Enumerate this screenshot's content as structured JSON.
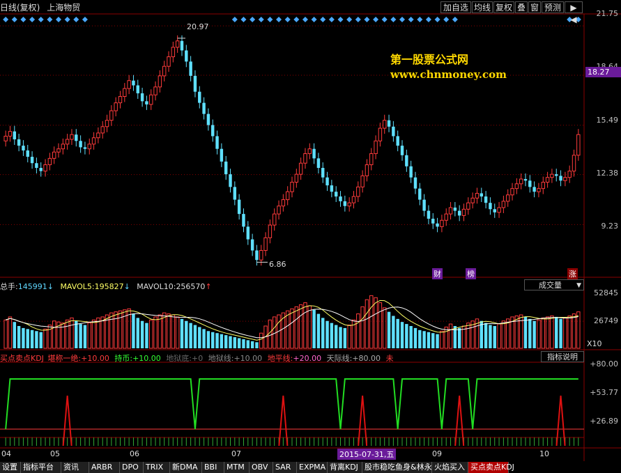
{
  "header": {
    "title": "日线(复权)",
    "stock_name": "上海物贸",
    "buttons": [
      "加自选",
      "均线",
      "复权",
      "叠",
      "窗",
      "预测",
      "▶ ◀"
    ]
  },
  "watermark": {
    "line1": "第一股票公式网",
    "line2": "www.chnmoney.com"
  },
  "price_panel": {
    "y_ticks": [
      "21.75",
      "18.64",
      "15.49",
      "12.38",
      "9.23"
    ],
    "current_price": "18.27",
    "high_label": "20.97",
    "low_label": "6.86",
    "badges": [
      "财",
      "榜",
      "涨"
    ],
    "accent_color": "#6a1b9a"
  },
  "volume_panel": {
    "label": "总手:",
    "total": "145991",
    "mavol5_label": "MAVOL5:",
    "mavol5": "195827",
    "mavol10_label": "MAVOL10:",
    "mavol10": "256570",
    "dropdown": "成交量",
    "y_ticks": [
      "52845",
      "26749"
    ],
    "multiplier": "X10"
  },
  "indicator_panel": {
    "title": "买点卖点KDJ",
    "line1_label": "堪称一绝:",
    "line1_value": "+10.00",
    "line2_label": "持币:",
    "line2_value": "+10.00",
    "line3_label": "地狱底:",
    "line3_value": "+0",
    "line4_label": "地狱线:",
    "line4_value": "+10.00",
    "line5_label": "地平线:",
    "line5_value": "+20.00",
    "line6_label": "天际线:",
    "line6_value": "+80.00",
    "line7_label": "未",
    "help_button": "指标说明",
    "y_ticks": [
      "+80.00",
      "+53.77",
      "+26.89"
    ]
  },
  "x_axis": {
    "labels": [
      "04",
      "05",
      "06",
      "07",
      "09",
      "10"
    ],
    "cursor_date": "2015-07-31,五"
  },
  "tabs": [
    "设置",
    "指标平台",
    "资讯",
    "ARBR",
    "DPO",
    "TRIX",
    "新DMA",
    "BBI",
    "MTM",
    "OBV",
    "SAR",
    "EXPMA",
    "背离KDJ",
    "股市稳吃鱼身&林永",
    "火焰买入",
    "买点卖点KDJ"
  ],
  "chart_data": {
    "type": "candlestick",
    "ylim": [
      6.0,
      22.5
    ],
    "close": [
      14.8,
      15.1,
      14.6,
      14.2,
      13.9,
      13.5,
      13.1,
      12.8,
      12.6,
      13.0,
      13.4,
      13.8,
      14.0,
      14.3,
      14.6,
      14.9,
      14.5,
      14.1,
      14.0,
      14.3,
      14.7,
      15.0,
      15.4,
      15.8,
      16.4,
      16.9,
      17.3,
      17.8,
      18.3,
      18.0,
      17.5,
      17.0,
      16.8,
      17.4,
      17.9,
      18.6,
      19.2,
      19.8,
      20.4,
      20.8,
      20.2,
      19.5,
      18.6,
      17.6,
      16.9,
      16.2,
      15.5,
      14.8,
      14.0,
      13.2,
      12.4,
      11.6,
      10.8,
      9.9,
      9.1,
      8.3,
      7.6,
      7.0,
      7.6,
      8.4,
      9.2,
      9.9,
      10.4,
      10.8,
      11.3,
      11.9,
      12.4,
      13.1,
      13.7,
      14.0,
      13.4,
      12.8,
      12.2,
      11.7,
      11.3,
      11.0,
      10.7,
      10.4,
      10.6,
      11.0,
      11.6,
      12.3,
      13.0,
      13.7,
      14.5,
      15.3,
      15.8,
      15.4,
      14.8,
      14.2,
      13.6,
      12.9,
      12.2,
      11.5,
      10.8,
      10.1,
      9.6,
      9.3,
      9.1,
      9.5,
      9.9,
      10.3,
      10.1,
      9.8,
      10.2,
      10.6,
      10.9,
      11.2,
      11.0,
      10.6,
      10.2,
      10.0,
      10.3,
      10.7,
      11.1,
      11.5,
      11.8,
      12.1,
      12.0,
      11.6,
      11.3,
      11.5,
      11.9,
      12.2,
      12.4,
      12.3,
      12.0,
      12.2,
      12.6,
      13.6,
      14.9
    ],
    "volume": [
      28000,
      31000,
      26000,
      22000,
      20000,
      19000,
      18000,
      17000,
      16000,
      19000,
      23000,
      27000,
      26000,
      25000,
      28000,
      30000,
      27000,
      24000,
      23000,
      25000,
      28000,
      30000,
      31000,
      33000,
      35000,
      36000,
      37000,
      38000,
      39000,
      34000,
      30000,
      27000,
      25000,
      28000,
      31000,
      33000,
      35000,
      34000,
      33000,
      31000,
      29000,
      27000,
      25000,
      23000,
      21000,
      19000,
      17000,
      16000,
      15000,
      14000,
      13000,
      12000,
      11000,
      10000,
      9000,
      8000,
      7000,
      6000,
      15000,
      22000,
      28000,
      31000,
      33000,
      35000,
      37000,
      39000,
      41000,
      43000,
      45000,
      42000,
      38000,
      34000,
      30000,
      27000,
      25000,
      23000,
      21000,
      20000,
      23000,
      28000,
      34000,
      41000,
      48000,
      52000,
      50000,
      45000,
      40000,
      36000,
      32000,
      29000,
      26000,
      24000,
      22000,
      20000,
      18000,
      17000,
      16000,
      15000,
      14000,
      17000,
      21000,
      24000,
      22000,
      20000,
      22000,
      25000,
      27000,
      29000,
      27000,
      25000,
      23000,
      22000,
      24000,
      27000,
      29000,
      31000,
      32000,
      33000,
      31000,
      29000,
      27000,
      28000,
      30000,
      31000,
      32000,
      31000,
      29000,
      30000,
      32000,
      34000,
      36000
    ],
    "volume_ylim": [
      0,
      55000
    ],
    "buy_signal_indices": [
      14,
      63,
      81,
      103,
      126
    ],
    "sell_signal_indices": [
      0,
      43,
      76,
      89,
      99,
      106
    ],
    "indicator_ylim": [
      0,
      100
    ]
  }
}
